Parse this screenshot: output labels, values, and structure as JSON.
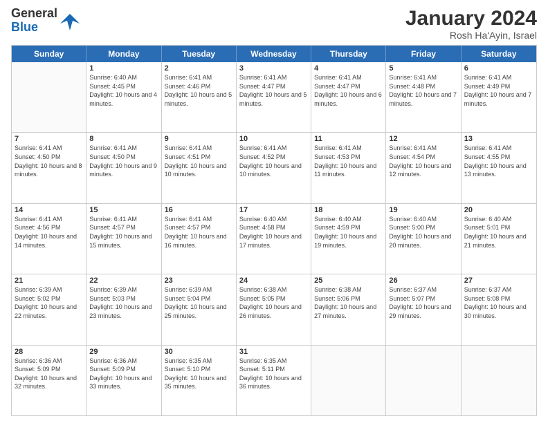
{
  "header": {
    "logo_general": "General",
    "logo_blue": "Blue",
    "month_title": "January 2024",
    "location": "Rosh Ha'Ayin, Israel"
  },
  "calendar": {
    "days_of_week": [
      "Sunday",
      "Monday",
      "Tuesday",
      "Wednesday",
      "Thursday",
      "Friday",
      "Saturday"
    ],
    "weeks": [
      [
        {
          "day": "",
          "empty": true
        },
        {
          "day": "1",
          "sunrise": "6:40 AM",
          "sunset": "4:45 PM",
          "daylight": "10 hours and 4 minutes."
        },
        {
          "day": "2",
          "sunrise": "6:41 AM",
          "sunset": "4:46 PM",
          "daylight": "10 hours and 5 minutes."
        },
        {
          "day": "3",
          "sunrise": "6:41 AM",
          "sunset": "4:47 PM",
          "daylight": "10 hours and 5 minutes."
        },
        {
          "day": "4",
          "sunrise": "6:41 AM",
          "sunset": "4:47 PM",
          "daylight": "10 hours and 6 minutes."
        },
        {
          "day": "5",
          "sunrise": "6:41 AM",
          "sunset": "4:48 PM",
          "daylight": "10 hours and 7 minutes."
        },
        {
          "day": "6",
          "sunrise": "6:41 AM",
          "sunset": "4:49 PM",
          "daylight": "10 hours and 7 minutes."
        }
      ],
      [
        {
          "day": "7",
          "sunrise": "6:41 AM",
          "sunset": "4:50 PM",
          "daylight": "10 hours and 8 minutes."
        },
        {
          "day": "8",
          "sunrise": "6:41 AM",
          "sunset": "4:50 PM",
          "daylight": "10 hours and 9 minutes."
        },
        {
          "day": "9",
          "sunrise": "6:41 AM",
          "sunset": "4:51 PM",
          "daylight": "10 hours and 10 minutes."
        },
        {
          "day": "10",
          "sunrise": "6:41 AM",
          "sunset": "4:52 PM",
          "daylight": "10 hours and 10 minutes."
        },
        {
          "day": "11",
          "sunrise": "6:41 AM",
          "sunset": "4:53 PM",
          "daylight": "10 hours and 11 minutes."
        },
        {
          "day": "12",
          "sunrise": "6:41 AM",
          "sunset": "4:54 PM",
          "daylight": "10 hours and 12 minutes."
        },
        {
          "day": "13",
          "sunrise": "6:41 AM",
          "sunset": "4:55 PM",
          "daylight": "10 hours and 13 minutes."
        }
      ],
      [
        {
          "day": "14",
          "sunrise": "6:41 AM",
          "sunset": "4:56 PM",
          "daylight": "10 hours and 14 minutes."
        },
        {
          "day": "15",
          "sunrise": "6:41 AM",
          "sunset": "4:57 PM",
          "daylight": "10 hours and 15 minutes."
        },
        {
          "day": "16",
          "sunrise": "6:41 AM",
          "sunset": "4:57 PM",
          "daylight": "10 hours and 16 minutes."
        },
        {
          "day": "17",
          "sunrise": "6:40 AM",
          "sunset": "4:58 PM",
          "daylight": "10 hours and 17 minutes."
        },
        {
          "day": "18",
          "sunrise": "6:40 AM",
          "sunset": "4:59 PM",
          "daylight": "10 hours and 19 minutes."
        },
        {
          "day": "19",
          "sunrise": "6:40 AM",
          "sunset": "5:00 PM",
          "daylight": "10 hours and 20 minutes."
        },
        {
          "day": "20",
          "sunrise": "6:40 AM",
          "sunset": "5:01 PM",
          "daylight": "10 hours and 21 minutes."
        }
      ],
      [
        {
          "day": "21",
          "sunrise": "6:39 AM",
          "sunset": "5:02 PM",
          "daylight": "10 hours and 22 minutes."
        },
        {
          "day": "22",
          "sunrise": "6:39 AM",
          "sunset": "5:03 PM",
          "daylight": "10 hours and 23 minutes."
        },
        {
          "day": "23",
          "sunrise": "6:39 AM",
          "sunset": "5:04 PM",
          "daylight": "10 hours and 25 minutes."
        },
        {
          "day": "24",
          "sunrise": "6:38 AM",
          "sunset": "5:05 PM",
          "daylight": "10 hours and 26 minutes."
        },
        {
          "day": "25",
          "sunrise": "6:38 AM",
          "sunset": "5:06 PM",
          "daylight": "10 hours and 27 minutes."
        },
        {
          "day": "26",
          "sunrise": "6:37 AM",
          "sunset": "5:07 PM",
          "daylight": "10 hours and 29 minutes."
        },
        {
          "day": "27",
          "sunrise": "6:37 AM",
          "sunset": "5:08 PM",
          "daylight": "10 hours and 30 minutes."
        }
      ],
      [
        {
          "day": "28",
          "sunrise": "6:36 AM",
          "sunset": "5:09 PM",
          "daylight": "10 hours and 32 minutes."
        },
        {
          "day": "29",
          "sunrise": "6:36 AM",
          "sunset": "5:09 PM",
          "daylight": "10 hours and 33 minutes."
        },
        {
          "day": "30",
          "sunrise": "6:35 AM",
          "sunset": "5:10 PM",
          "daylight": "10 hours and 35 minutes."
        },
        {
          "day": "31",
          "sunrise": "6:35 AM",
          "sunset": "5:11 PM",
          "daylight": "10 hours and 36 minutes."
        },
        {
          "day": "",
          "empty": true
        },
        {
          "day": "",
          "empty": true
        },
        {
          "day": "",
          "empty": true
        }
      ]
    ]
  }
}
